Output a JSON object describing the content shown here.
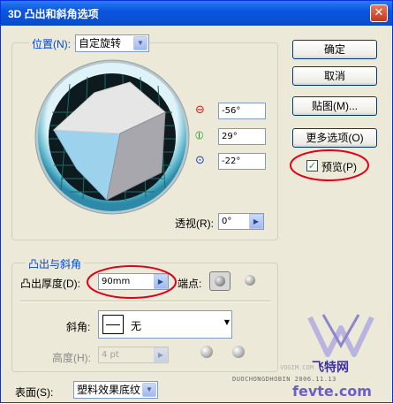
{
  "window": {
    "title": "3D 凸出和斜角选项",
    "close_icon": "close-icon",
    "accent": "#0a55e0"
  },
  "position": {
    "label": "位置(N):",
    "value": "自定旋转",
    "x_icon": "rotate-x-icon",
    "y_icon": "rotate-y-icon",
    "z_icon": "rotate-z-icon",
    "x_value": "-56°",
    "y_value": "29°",
    "z_value": "-22°",
    "perspective_label": "透视(R):",
    "perspective_value": "0°"
  },
  "buttons": {
    "ok": "确定",
    "cancel": "取消",
    "map": "贴图(M)...",
    "more": "更多选项(O)"
  },
  "preview": {
    "label": "预览(P)",
    "checked": true
  },
  "extrude": {
    "group_title": "凸出与斜角",
    "depth_label": "凸出厚度(D):",
    "depth_value": "90mm",
    "cap_label": "端点:",
    "bevel_label": "斜角:",
    "bevel_value": "无",
    "height_label": "高度(H):",
    "height_value": "4 pt"
  },
  "surface": {
    "label": "表面(S):",
    "value": "塑料效果底纹"
  },
  "watermark": {
    "left": "DUOCHONGDHOBIN 2006.11.13",
    "right": "VOGIM.COM",
    "brand": "飞特网",
    "domain": "fevte.com"
  },
  "colors": {
    "highlight_ellipse": "#e0001a",
    "cube_top": "#e9e9e9",
    "cube_left": "#9dd2ec",
    "cube_right": "#a8a8ae"
  }
}
